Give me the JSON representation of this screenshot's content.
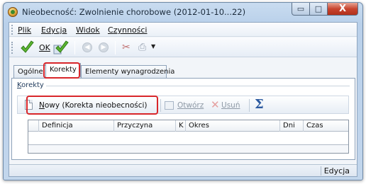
{
  "window": {
    "title": "Nieobecność: Zwolnienie chorobowe (2012-01-10...22)",
    "caption_buttons": {
      "minimize": "▭",
      "maximize": "□",
      "close": "X"
    }
  },
  "menu": {
    "items": [
      {
        "key": "P",
        "rest": "lik"
      },
      {
        "key": "E",
        "rest": "dycja"
      },
      {
        "key": "W",
        "rest": "idok"
      },
      {
        "key": "C",
        "rest": "zynności"
      }
    ]
  },
  "toolbar": {
    "ok_label": "OK",
    "icons": [
      "check-ok-icon",
      "check-save-icon",
      "back-icon",
      "forward-icon",
      "tools-icon",
      "print-icon"
    ]
  },
  "tabs": [
    {
      "label": "Ogólne"
    },
    {
      "label": "Korekty",
      "active": true
    },
    {
      "label": "Elementy wynagrodzenia"
    }
  ],
  "group": {
    "title_key": "K",
    "title_rest": "orekty"
  },
  "sub_toolbar": {
    "new_key": "N",
    "new_rest": "owy (Korekta nieobecności)",
    "open_key": "O",
    "open_rest": "twórz",
    "delete_key": "U",
    "delete_rest": "suń",
    "sigma": "Σ"
  },
  "grid": {
    "columns": [
      "Definicja",
      "Przyczyna",
      "K",
      "Okres",
      "Dni",
      "Czas"
    ]
  },
  "status": {
    "text": "Edycja"
  },
  "colors": {
    "highlight": "#d8262a",
    "sigma": "#2c5aa0"
  }
}
